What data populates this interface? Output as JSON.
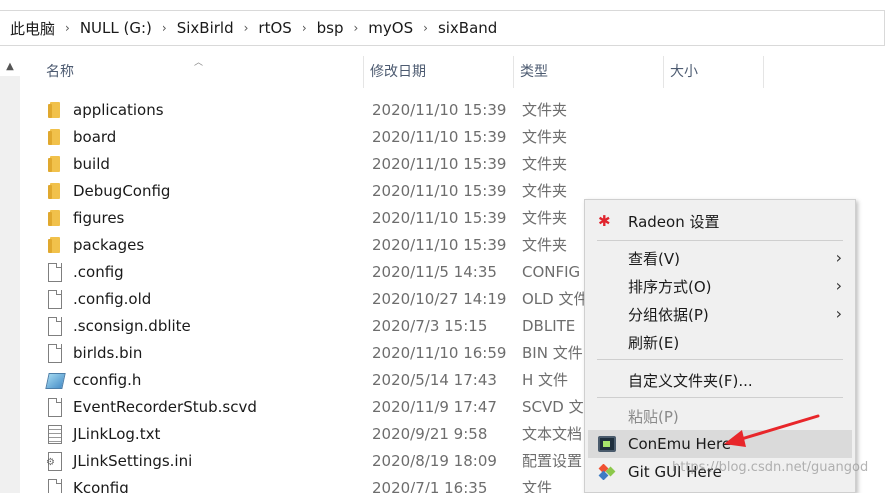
{
  "breadcrumb": [
    "此电脑",
    "NULL (G:)",
    "SixBirld",
    "rtOS",
    "bsp",
    "myOS",
    "sixBand"
  ],
  "columns": {
    "name": "名称",
    "date": "修改日期",
    "type": "类型",
    "size": "大小"
  },
  "files": [
    {
      "name": "applications",
      "date": "2020/11/10 15:39",
      "type": "文件夹",
      "icon": "folder-icon"
    },
    {
      "name": "board",
      "date": "2020/11/10 15:39",
      "type": "文件夹",
      "icon": "folder-icon"
    },
    {
      "name": "build",
      "date": "2020/11/10 15:39",
      "type": "文件夹",
      "icon": "folder-icon"
    },
    {
      "name": "DebugConfig",
      "date": "2020/11/10 15:39",
      "type": "文件夹",
      "icon": "folder-icon"
    },
    {
      "name": "figures",
      "date": "2020/11/10 15:39",
      "type": "文件夹",
      "icon": "folder-icon"
    },
    {
      "name": "packages",
      "date": "2020/11/10 15:39",
      "type": "文件夹",
      "icon": "folder-icon"
    },
    {
      "name": ".config",
      "date": "2020/11/5 14:35",
      "type": "CONFIG",
      "icon": "file-icon"
    },
    {
      "name": ".config.old",
      "date": "2020/10/27 14:19",
      "type": "OLD 文件",
      "icon": "file-icon"
    },
    {
      "name": ".sconsign.dblite",
      "date": "2020/7/3 15:15",
      "type": "DBLITE",
      "icon": "file-icon"
    },
    {
      "name": "birlds.bin",
      "date": "2020/11/10 16:59",
      "type": "BIN 文件",
      "icon": "file-icon"
    },
    {
      "name": "cconfig.h",
      "date": "2020/5/14 17:43",
      "type": "H 文件",
      "icon": "h-file-icon"
    },
    {
      "name": "EventRecorderStub.scvd",
      "date": "2020/11/9 17:47",
      "type": "SCVD 文",
      "icon": "file-icon"
    },
    {
      "name": "JLinkLog.txt",
      "date": "2020/9/21 9:58",
      "type": "文本文档",
      "icon": "text-file-icon"
    },
    {
      "name": "JLinkSettings.ini",
      "date": "2020/8/19 18:09",
      "type": "配置设置",
      "icon": "settings-file-icon"
    },
    {
      "name": "Kconfig",
      "date": "2020/7/1 16:35",
      "type": "文件",
      "icon": "file-icon"
    }
  ],
  "context_menu": {
    "radeon": "Radeon 设置",
    "view": "查看(V)",
    "sort": "排序方式(O)",
    "group": "分组依据(P)",
    "refresh": "刷新(E)",
    "customize": "自定义文件夹(F)...",
    "paste": "粘贴(P)",
    "conemu": "ConEmu Here",
    "git_gui": "Git GUI Here"
  },
  "watermark": "https://blog.csdn.net/guangod",
  "colors": {
    "annotation_arrow": "#e8262a",
    "folder": "#f1c14b",
    "menu_hover": "#dadada"
  }
}
